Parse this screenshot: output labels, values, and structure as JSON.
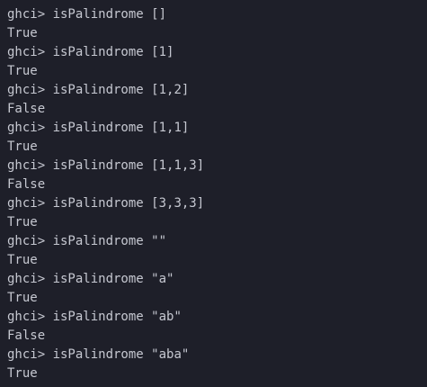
{
  "prompt": "ghci> ",
  "entries": [
    {
      "command": "isPalindrome []",
      "output": "True"
    },
    {
      "command": "isPalindrome [1]",
      "output": "True"
    },
    {
      "command": "isPalindrome [1,2]",
      "output": "False"
    },
    {
      "command": "isPalindrome [1,1]",
      "output": "True"
    },
    {
      "command": "isPalindrome [1,1,3]",
      "output": "False"
    },
    {
      "command": "isPalindrome [3,3,3]",
      "output": "True"
    },
    {
      "command": "isPalindrome \"\"",
      "output": "True"
    },
    {
      "command": "isPalindrome \"a\"",
      "output": "True"
    },
    {
      "command": "isPalindrome \"ab\"",
      "output": "False"
    },
    {
      "command": "isPalindrome \"aba\"",
      "output": "True"
    }
  ]
}
